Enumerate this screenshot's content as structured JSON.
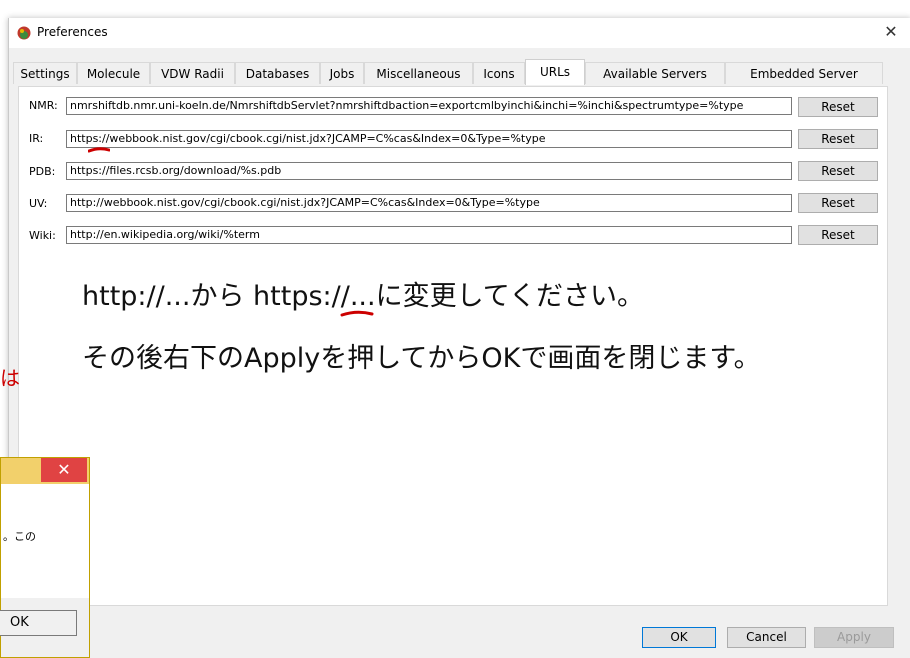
{
  "window": {
    "title": "Preferences",
    "close_glyph": "✕"
  },
  "tabs": [
    {
      "label": "Settings"
    },
    {
      "label": "Molecule"
    },
    {
      "label": "VDW Radii"
    },
    {
      "label": "Databases"
    },
    {
      "label": "Jobs"
    },
    {
      "label": "Miscellaneous"
    },
    {
      "label": "Icons"
    },
    {
      "label": "URLs"
    },
    {
      "label": "Available Servers"
    },
    {
      "label": "Embedded Server"
    }
  ],
  "active_tab": "URLs",
  "urls": [
    {
      "label": "NMR:",
      "value": "nmrshiftdb.nmr.uni-koeln.de/NmrshiftdbServlet?nmrshiftdbaction=exportcmlbyinchi&inchi=%inchi&spectrumtype=%type",
      "reset": "Reset"
    },
    {
      "label": "IR:",
      "value": "https://webbook.nist.gov/cgi/cbook.cgi/nist.jdx?JCAMP=C%cas&Index=0&Type=%type",
      "reset": "Reset"
    },
    {
      "label": "PDB:",
      "value": "https://files.rcsb.org/download/%s.pdb",
      "reset": "Reset"
    },
    {
      "label": "UV:",
      "value": "http://webbook.nist.gov/cgi/cbook.cgi/nist.jdx?JCAMP=C%cas&Index=0&Type=%type",
      "reset": "Reset"
    },
    {
      "label": "Wiki:",
      "value": "http://en.wikipedia.org/wiki/%term",
      "reset": "Reset"
    }
  ],
  "annotation": {
    "line1": "http://...から https://...に変更してください。",
    "line2": "その後右下のApplyを押してからOKで画面を閉じます。",
    "side_char": "は",
    "underline_color": "#cc0000"
  },
  "buttons": {
    "ok": "OK",
    "cancel": "Cancel",
    "apply": "Apply"
  },
  "second_dialog": {
    "close_glyph": "✕",
    "text": "。この",
    "ok": "OK"
  },
  "colors": {
    "accent_close": "#e04343",
    "annotation_red": "#cc0000"
  }
}
